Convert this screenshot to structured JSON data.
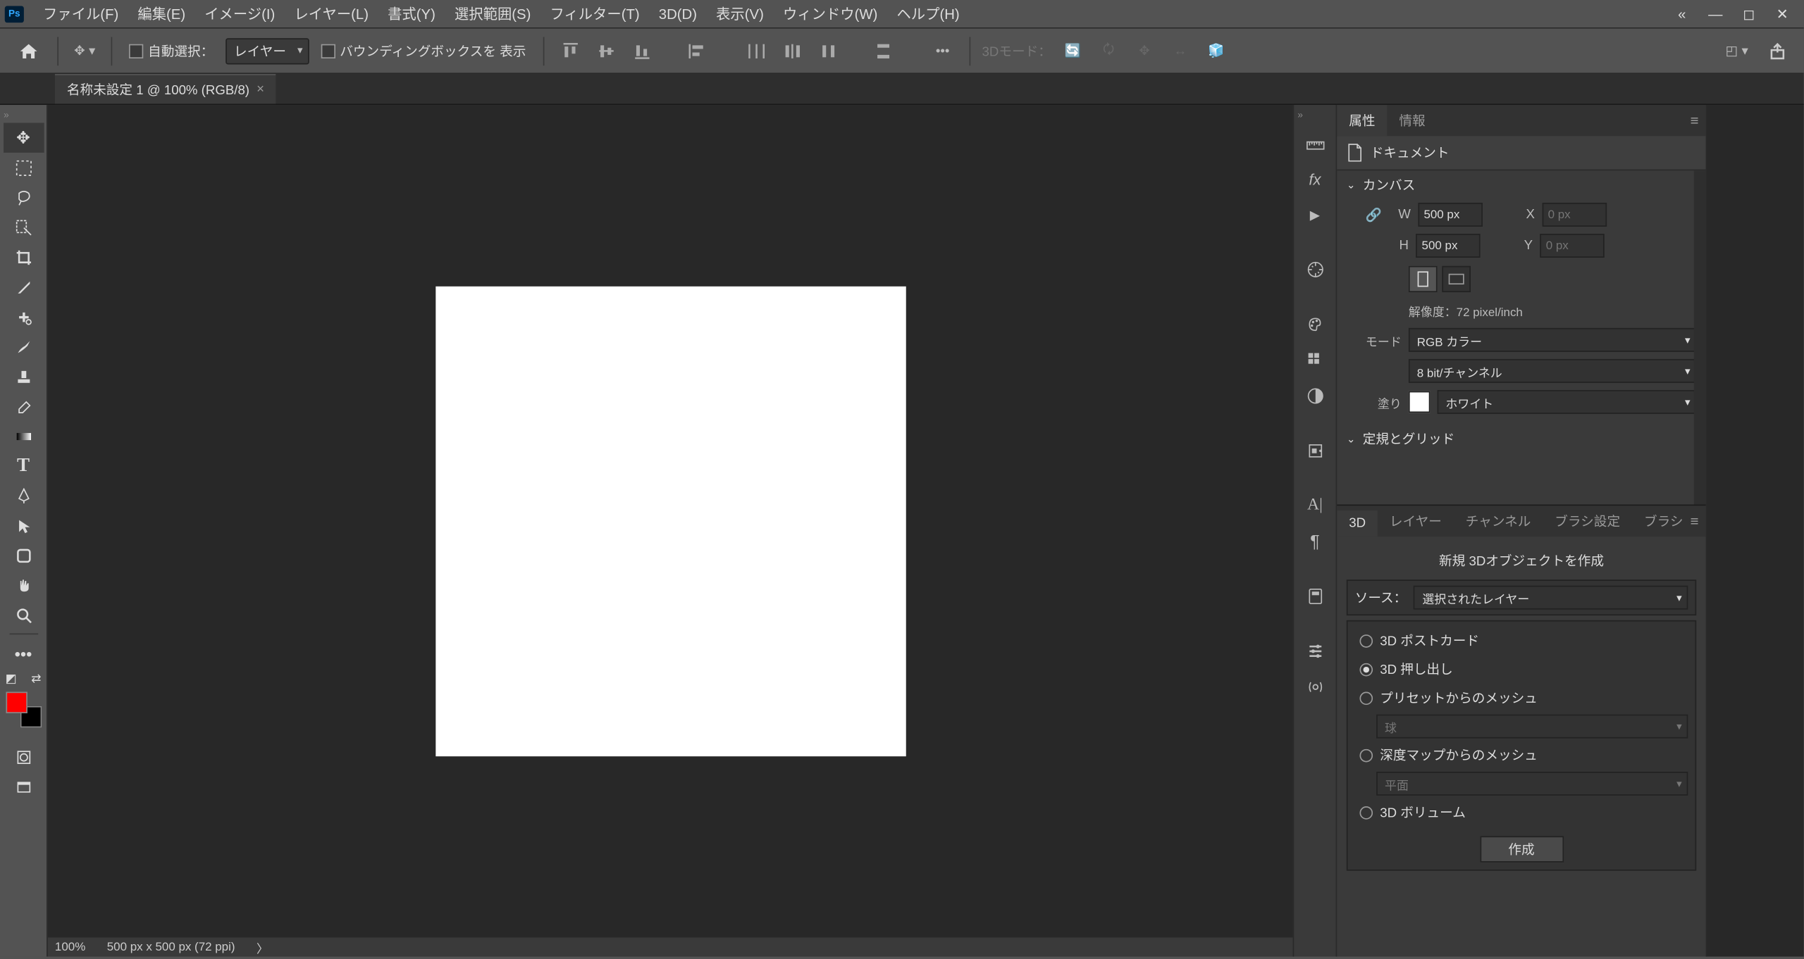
{
  "menubar": {
    "logo": "Ps",
    "items": [
      "ファイル(F)",
      "編集(E)",
      "イメージ(I)",
      "レイヤー(L)",
      "書式(Y)",
      "選択範囲(S)",
      "フィルター(T)",
      "3D(D)",
      "表示(V)",
      "ウィンドウ(W)",
      "ヘルプ(H)"
    ]
  },
  "optionbar": {
    "auto_select": "自動選択：",
    "layer_select": "レイヤー",
    "show_bounding": "バウンディングボックスを 表示",
    "mode3d": "3Dモード："
  },
  "doc_tab": {
    "title": "名称未設定 1 @ 100% (RGB/8)"
  },
  "statusbar": {
    "zoom": "100%",
    "dims": "500 px x 500 px (72 ppi)"
  },
  "panel_props": {
    "tab_props": "属性",
    "tab_info": "情報",
    "doc_label": "ドキュメント",
    "canvas_section": "カンバス",
    "w_label": "W",
    "w_value": "500 px",
    "h_label": "H",
    "h_value": "500 px",
    "x_label": "X",
    "x_placeholder": "0 px",
    "y_label": "Y",
    "y_placeholder": "0 px",
    "resolution": "解像度：72 pixel/inch",
    "mode_label": "モード",
    "mode_value": "RGB カラー",
    "depth_value": "8 bit/チャンネル",
    "fill_label": "塗り",
    "fill_value": "ホワイト",
    "rulers_section": "定規とグリッド"
  },
  "panel_3d": {
    "tabs": [
      "3D",
      "レイヤー",
      "チャンネル",
      "ブラシ設定",
      "ブラシ"
    ],
    "title": "新規 3Dオブジェクトを作成",
    "source_label": "ソース：",
    "source_value": "選択されたレイヤー",
    "opt_postcard": "3D ポストカード",
    "opt_extrusion": "3D 押し出し",
    "opt_preset": "プリセットからのメッシュ",
    "preset_sub": "球",
    "opt_depth": "深度マップからのメッシュ",
    "depth_sub": "平面",
    "opt_volume": "3D ボリューム",
    "create_btn": "作成"
  }
}
